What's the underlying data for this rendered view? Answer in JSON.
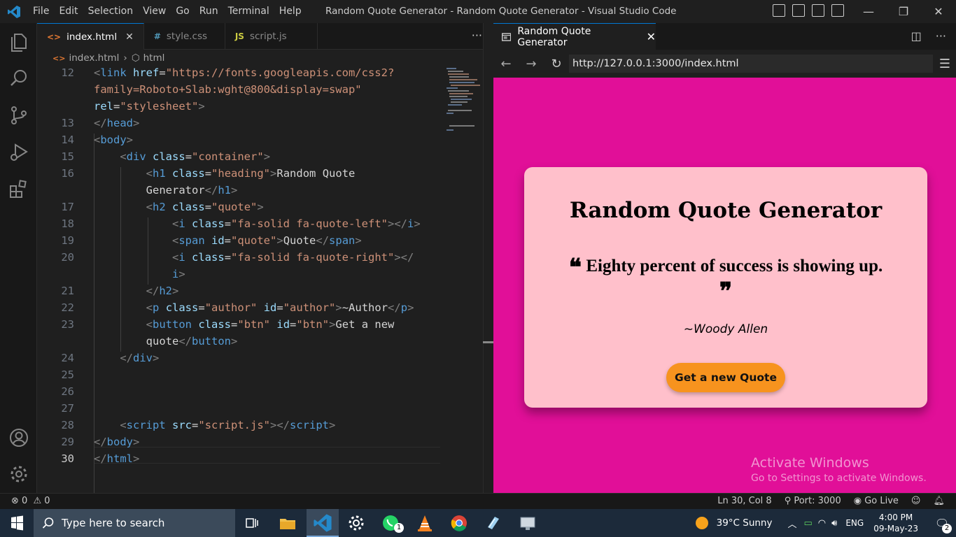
{
  "titlebar": {
    "menu": [
      "File",
      "Edit",
      "Selection",
      "View",
      "Go",
      "Run",
      "Terminal",
      "Help"
    ],
    "title": "Random Quote Generator - Random Quote Generator - Visual Studio Code"
  },
  "editor": {
    "tabs": [
      {
        "icon": "<>",
        "label": "index.html",
        "active": true
      },
      {
        "icon": "#",
        "label": "style.css",
        "active": false
      },
      {
        "icon": "JS",
        "label": "script.js",
        "active": false
      }
    ],
    "more": "···",
    "breadcrumb": {
      "file": "index.html",
      "node": "html"
    },
    "lines": [
      {
        "n": "12",
        "html": "<span class='br'>&lt;</span><span class='tag'>link</span> <span class='att'>href</span><span class='plain'>=</span><span class='str'>\"https://fonts.googleapis.com/css2?</span>"
      },
      {
        "n": "",
        "html": "<span class='str'>family=Roboto+Slab:wght@800&amp;display=swap\"</span>"
      },
      {
        "n": "",
        "html": "<span class='att'>rel</span><span class='plain'>=</span><span class='str'>\"stylesheet\"</span><span class='br'>&gt;</span>"
      },
      {
        "n": "13",
        "html": "<span class='br'>&lt;/</span><span class='tag'>head</span><span class='br'>&gt;</span>"
      },
      {
        "n": "14",
        "html": "<span class='br'>&lt;</span><span class='tag'>body</span><span class='br'>&gt;</span>"
      },
      {
        "n": "15",
        "html": "    <span class='br'>&lt;</span><span class='tag'>div</span> <span class='att'>class</span><span class='plain'>=</span><span class='str'>\"container\"</span><span class='br'>&gt;</span>"
      },
      {
        "n": "16",
        "html": "        <span class='br'>&lt;</span><span class='tag'>h1</span> <span class='att'>class</span><span class='plain'>=</span><span class='str'>\"heading\"</span><span class='br'>&gt;</span><span class='plain'>Random Quote</span>"
      },
      {
        "n": "",
        "html": "        <span class='plain'>Generator</span><span class='br'>&lt;/</span><span class='tag'>h1</span><span class='br'>&gt;</span>"
      },
      {
        "n": "17",
        "html": "        <span class='br'>&lt;</span><span class='tag'>h2</span> <span class='att'>class</span><span class='plain'>=</span><span class='str'>\"quote\"</span><span class='br'>&gt;</span>"
      },
      {
        "n": "18",
        "html": "            <span class='br'>&lt;</span><span class='tag'>i</span> <span class='att'>class</span><span class='plain'>=</span><span class='str'>\"fa-solid fa-quote-left\"</span><span class='br'>&gt;&lt;/</span><span class='tag'>i</span><span class='br'>&gt;</span>"
      },
      {
        "n": "19",
        "html": "            <span class='br'>&lt;</span><span class='tag'>span</span> <span class='att'>id</span><span class='plain'>=</span><span class='str'>\"quote\"</span><span class='br'>&gt;</span><span class='plain'>Quote</span><span class='br'>&lt;/</span><span class='tag'>span</span><span class='br'>&gt;</span>"
      },
      {
        "n": "20",
        "html": "            <span class='br'>&lt;</span><span class='tag'>i</span> <span class='att'>class</span><span class='plain'>=</span><span class='str'>\"fa-solid fa-quote-right\"</span><span class='br'>&gt;&lt;/</span>"
      },
      {
        "n": "",
        "html": "            <span class='tag'>i</span><span class='br'>&gt;</span>"
      },
      {
        "n": "21",
        "html": "        <span class='br'>&lt;/</span><span class='tag'>h2</span><span class='br'>&gt;</span>"
      },
      {
        "n": "22",
        "html": "        <span class='br'>&lt;</span><span class='tag'>p</span> <span class='att'>class</span><span class='plain'>=</span><span class='str'>\"author\"</span> <span class='att'>id</span><span class='plain'>=</span><span class='str'>\"author\"</span><span class='br'>&gt;</span><span class='plain'>~Author</span><span class='br'>&lt;/</span><span class='tag'>p</span><span class='br'>&gt;</span>"
      },
      {
        "n": "23",
        "html": "        <span class='br'>&lt;</span><span class='tag'>button</span> <span class='att'>class</span><span class='plain'>=</span><span class='str'>\"btn\"</span> <span class='att'>id</span><span class='plain'>=</span><span class='str'>\"btn\"</span><span class='br'>&gt;</span><span class='plain'>Get a new</span>"
      },
      {
        "n": "",
        "html": "        <span class='plain'>quote</span><span class='br'>&lt;/</span><span class='tag'>button</span><span class='br'>&gt;</span>"
      },
      {
        "n": "24",
        "html": "    <span class='br'>&lt;/</span><span class='tag'>div</span><span class='br'>&gt;</span>"
      },
      {
        "n": "25",
        "html": ""
      },
      {
        "n": "26",
        "html": ""
      },
      {
        "n": "27",
        "html": ""
      },
      {
        "n": "28",
        "html": "    <span class='br'>&lt;</span><span class='tag'>script</span> <span class='att'>src</span><span class='plain'>=</span><span class='str'>\"script.js\"</span><span class='br'>&gt;&lt;/</span><span class='tag'>script</span><span class='br'>&gt;</span>"
      },
      {
        "n": "29",
        "html": "<span class='br'>&lt;/</span><span class='tag'>body</span><span class='br'>&gt;</span>"
      },
      {
        "n": "30",
        "html": "<span class='br'>&lt;/</span><span class='tag'>html</span><span class='br'>&gt;</span>"
      }
    ]
  },
  "preview": {
    "tab_label": "Random Quote Generator",
    "url": "http://127.0.0.1:3000/index.html",
    "page_bg": "#e10f98",
    "card_bg": "#ffc0cb",
    "button_color": "#f7931e",
    "heading": "Random Quote Generator",
    "quote_left": "❝",
    "quote_text": "Eighty percent of success is showing up.",
    "quote_right": "❞",
    "author": "~Woody Allen",
    "button_label": "Get a new Quote",
    "activate_title": "Activate Windows",
    "activate_sub": "Go to Settings to activate Windows."
  },
  "status": {
    "errors": "0",
    "warnings": "0",
    "position": "Ln 30, Col 8",
    "port": "Port: 3000",
    "golive": "Go Live"
  },
  "taskbar": {
    "search_placeholder": "Type here to search",
    "whatsapp_badge": "1",
    "weather": "39°C  Sunny",
    "lang": "ENG",
    "time": "4:00 PM",
    "date": "09-May-23",
    "notif_count": "2"
  }
}
